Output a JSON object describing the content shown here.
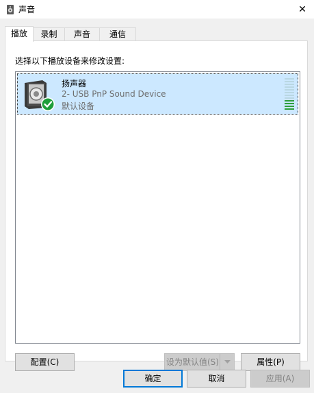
{
  "window": {
    "title": "声音",
    "close_glyph": "✕"
  },
  "tabs": [
    {
      "label": "播放",
      "active": true
    },
    {
      "label": "录制",
      "active": false
    },
    {
      "label": "声音",
      "active": false
    },
    {
      "label": "通信",
      "active": false
    }
  ],
  "panel": {
    "instruction": "选择以下播放设备来修改设置:"
  },
  "devices": [
    {
      "name": "扬声器",
      "description": "2- USB PnP Sound Device",
      "status": "默认设备",
      "icon": "speaker-icon",
      "default_badge_icon": "green-check-icon",
      "level_fraction": 0.35,
      "selected": true
    }
  ],
  "buttons": {
    "configure": "配置(C)",
    "set_default": "设为默认值(S)",
    "properties": "属性(P)",
    "ok": "确定",
    "cancel": "取消",
    "apply": "应用(A)"
  },
  "colors": {
    "selection": "#cce8ff",
    "meter_active": "#2e9e3c",
    "meter_idle": "#b9d7e3",
    "focus": "#0078d7"
  }
}
